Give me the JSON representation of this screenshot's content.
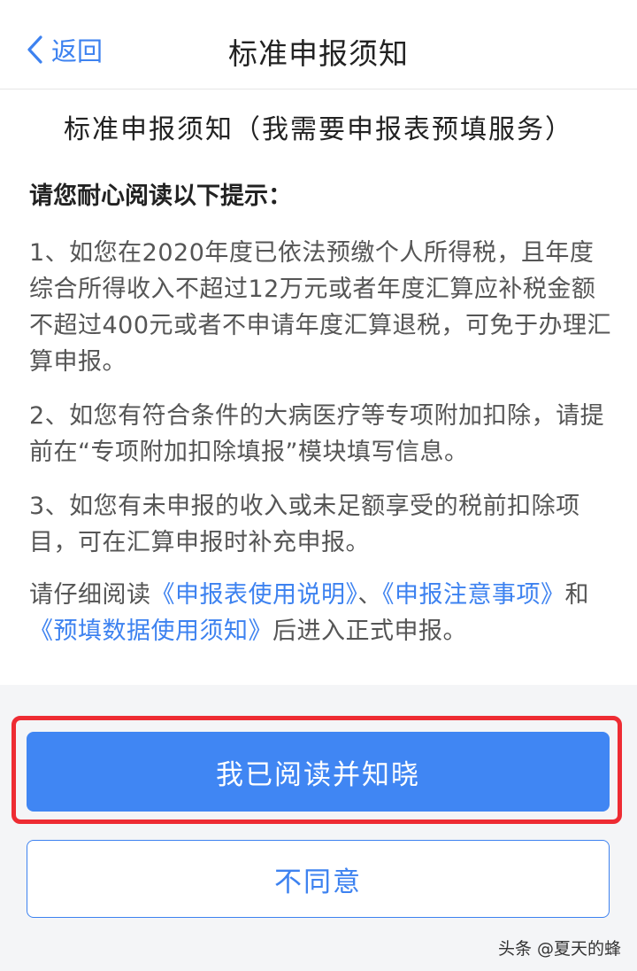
{
  "nav": {
    "back_label": "返回",
    "title": "标准申报须知"
  },
  "doc": {
    "title": "标准申报须知（我需要申报表预填服务）",
    "intro": "请您耐心阅读以下提示：",
    "item1": "1、如您在2020年度已依法预缴个人所得税，且年度综合所得收入不超过12万元或者年度汇算应补税金额不超过400元或者不申请年度汇算退税，可免于办理汇算申报。",
    "item2": "2、如您有符合条件的大病医疗等专项附加扣除，请提前在“专项附加扣除填报”模块填写信息。",
    "item3": "3、如您有未申报的收入或未足额享受的税前扣除项目，可在汇算申报时补充申报。",
    "closing": {
      "prefix": "请仔细阅读",
      "link1": "《申报表使用说明》",
      "sep": "、",
      "link2": "《申报注意事项》",
      "and": "和",
      "link3": "《预填数据使用须知》",
      "suffix": "后进入正式申报。"
    }
  },
  "buttons": {
    "agree": "我已阅读并知晓",
    "disagree": "不同意"
  },
  "watermark": "头条 @夏天的蜂",
  "colors": {
    "accent": "#3d82f0",
    "primary": "#4086f3",
    "highlight": "#ee2c33"
  }
}
